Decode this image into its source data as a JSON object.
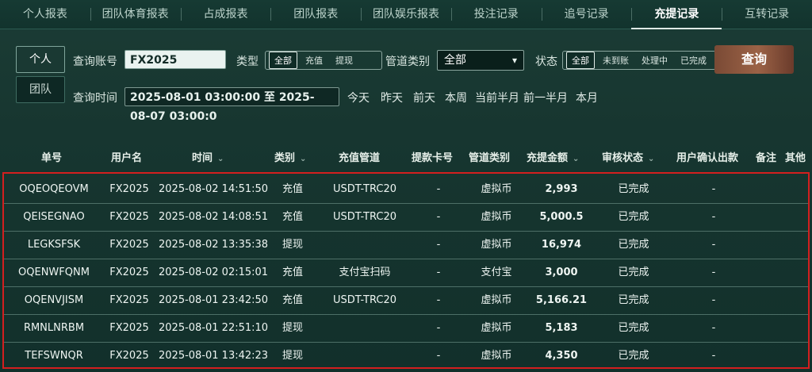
{
  "tabs": [
    "个人报表",
    "团队体育报表",
    "占成报表",
    "团队报表",
    "团队娱乐报表",
    "投注记录",
    "追号记录",
    "充提记录",
    "互转记录"
  ],
  "active_tab": "充提记录",
  "toggle": {
    "personal": "个人",
    "team": "团队"
  },
  "filters": {
    "account_label": "查询账号",
    "account_value": "FX2025",
    "type_label": "类型",
    "type_options": [
      "全部",
      "充值",
      "提现"
    ],
    "type_selected": "全部",
    "channel_label": "管道类别",
    "channel_value": "全部",
    "status_label": "状态",
    "status_options": [
      "全部",
      "未到账",
      "处理中",
      "已完成"
    ],
    "status_selected": "全部",
    "query_button": "查询",
    "time_label": "查询时间",
    "time_value": "2025-08-01 03:00:00 至 2025-08-07 03:00:0",
    "quick_ranges": [
      "今天",
      "昨天",
      "前天",
      "本周",
      "当前半月",
      "前一半月",
      "本月"
    ]
  },
  "table": {
    "headers": [
      "单号",
      "用户名",
      "时间",
      "类别",
      "充值管道",
      "提款卡号",
      "管道类别",
      "充提金额",
      "审核状态",
      "用户确认出款",
      "备注",
      "其他"
    ],
    "rows": [
      [
        "OQEOQEOVM",
        "FX2025",
        "2025-08-02 14:51:50",
        "充值",
        "USDT-TRC20",
        "-",
        "虚拟币",
        "2,993",
        "已完成",
        "-"
      ],
      [
        "QEISEGNAO",
        "FX2025",
        "2025-08-02 14:08:51",
        "充值",
        "USDT-TRC20",
        "-",
        "虚拟币",
        "5,000.5",
        "已完成",
        "-"
      ],
      [
        "LEGKSFSK",
        "FX2025",
        "2025-08-02 13:35:38",
        "提现",
        "",
        "-",
        "虚拟币",
        "16,974",
        "已完成",
        "-"
      ],
      [
        "OQENWFQNM",
        "FX2025",
        "2025-08-02 02:15:01",
        "充值",
        "支付宝扫码",
        "-",
        "支付宝",
        "3,000",
        "已完成",
        "-"
      ],
      [
        "OQENVJISM",
        "FX2025",
        "2025-08-01 23:42:50",
        "充值",
        "USDT-TRC20",
        "-",
        "虚拟币",
        "5,166.21",
        "已完成",
        "-"
      ],
      [
        "RMNLNRBM",
        "FX2025",
        "2025-08-01 22:51:10",
        "提现",
        "",
        "-",
        "虚拟币",
        "5,183",
        "已完成",
        "-"
      ],
      [
        "TEFSWNQR",
        "FX2025",
        "2025-08-01 13:42:23",
        "提现",
        "",
        "-",
        "虚拟币",
        "4,350",
        "已完成",
        "-"
      ]
    ]
  }
}
